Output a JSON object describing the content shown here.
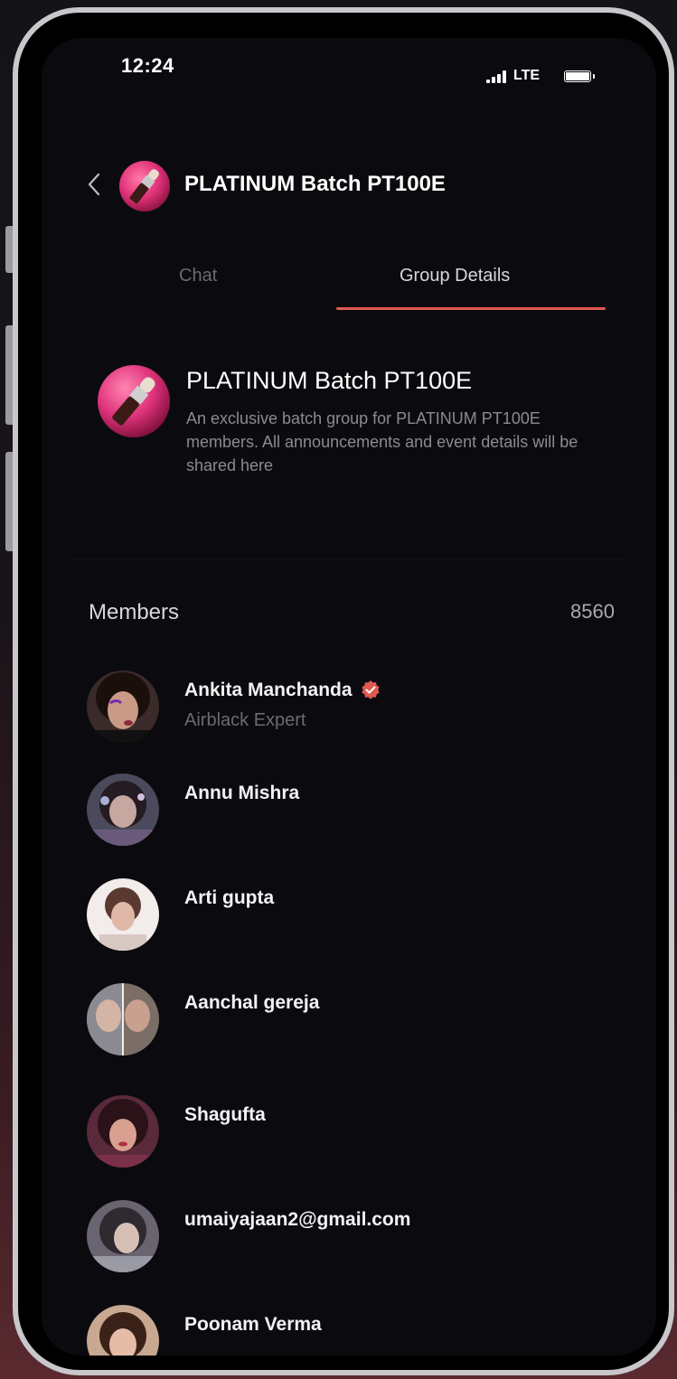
{
  "status_bar": {
    "time": "12:24",
    "network": "LTE"
  },
  "header": {
    "title": "PLATINUM Batch PT100E",
    "back_icon": "chevron-left-icon"
  },
  "tabs": [
    {
      "label": "Chat",
      "active": false
    },
    {
      "label": "Group Details",
      "active": true
    }
  ],
  "group": {
    "name": "PLATINUM Batch PT100E",
    "description": "An exclusive batch group for PLATINUM PT100E members. All announcements and event details will be shared here"
  },
  "members": {
    "label": "Members",
    "count": "8560",
    "list": [
      {
        "name": "Ankita Manchanda",
        "role": "Airblack Expert",
        "verified": true
      },
      {
        "name": "Annu Mishra"
      },
      {
        "name": "Arti gupta"
      },
      {
        "name": "Aanchal gereja"
      },
      {
        "name": "Shagufta"
      },
      {
        "name": "umaiyajaan2@gmail.com"
      },
      {
        "name": "Poonam Verma"
      }
    ]
  },
  "colors": {
    "accent": "#e05a52",
    "background": "#0b0b0f",
    "verified": "#e05a52"
  }
}
